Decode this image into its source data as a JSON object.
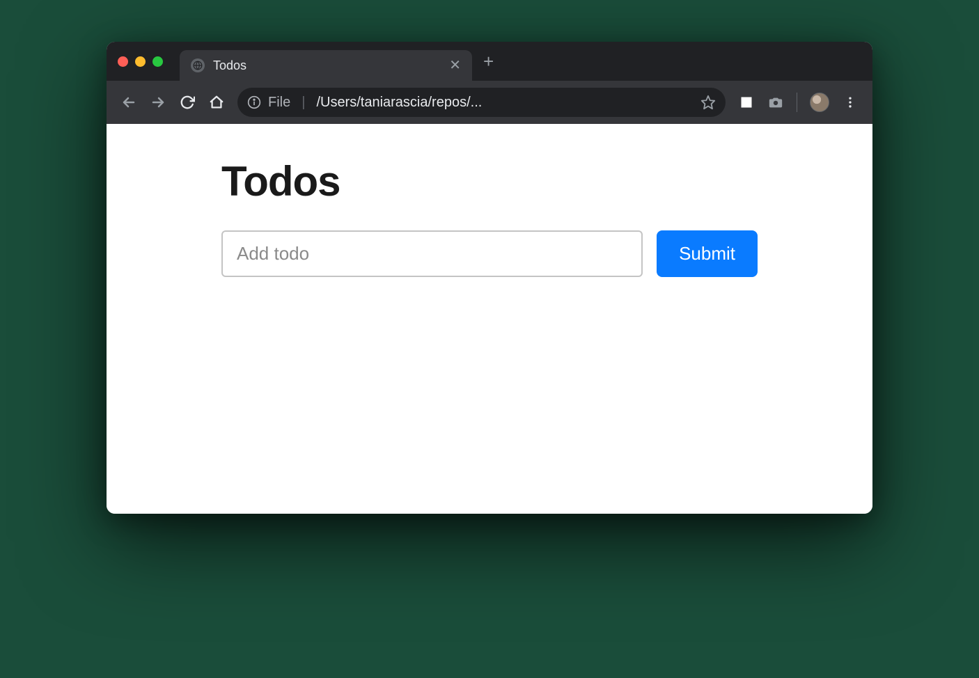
{
  "browser": {
    "tab": {
      "title": "Todos"
    },
    "address": {
      "scheme": "File",
      "path": "/Users/taniarascia/repos/..."
    }
  },
  "page": {
    "title": "Todos",
    "form": {
      "input_placeholder": "Add todo",
      "input_value": "",
      "submit_label": "Submit"
    }
  },
  "colors": {
    "accent": "#0a7bff",
    "chrome_dark": "#202124",
    "chrome_mid": "#35363a"
  }
}
